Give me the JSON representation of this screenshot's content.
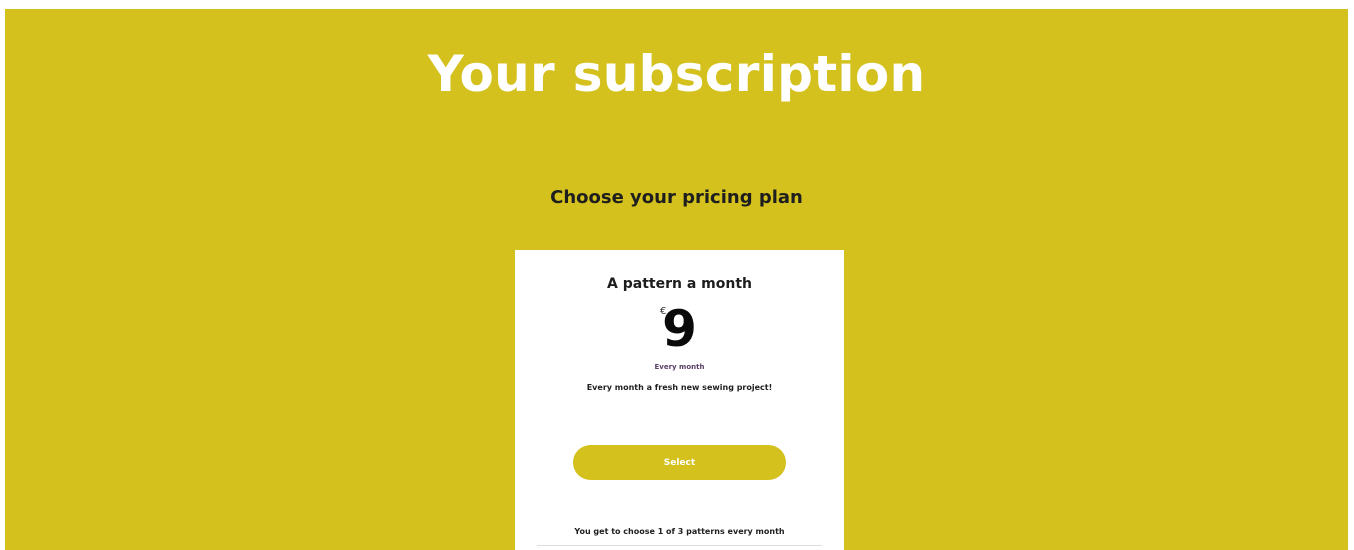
{
  "page": {
    "title": "Your subscription",
    "subtitle": "Choose your pricing plan"
  },
  "plan": {
    "name": "A pattern a month",
    "currency": "€",
    "price": "9",
    "period": "Every month",
    "description": "Every month a fresh new sewing project!",
    "select_label": "Select",
    "feature": "You get to choose 1 of 3 patterns every month"
  },
  "colors": {
    "background_accent": "#d4c11d",
    "card_background": "#ffffff",
    "title_text": "#ffffff"
  }
}
